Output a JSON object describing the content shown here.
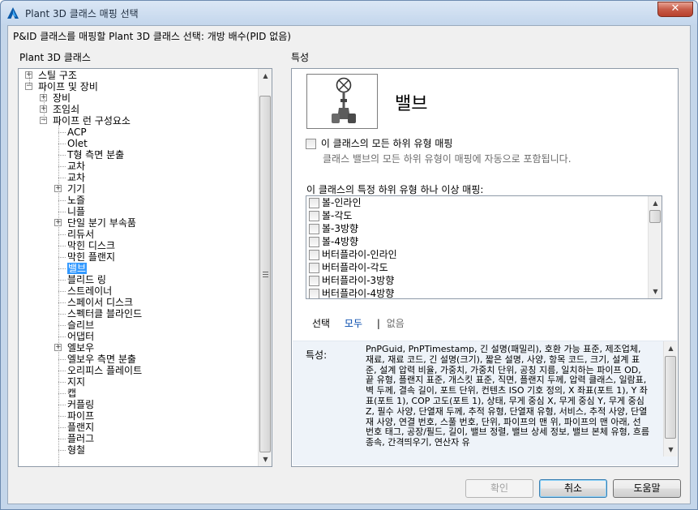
{
  "window": {
    "title": "Plant 3D 클래스 매핑 선택",
    "close_glyph": "✕"
  },
  "prompt": "P&ID 클래스를 매핑할 Plant 3D 클래스 선택: 개방 배수(PID 없음)",
  "left_label": "Plant 3D 클래스",
  "right_label": "특성",
  "tree": {
    "items": [
      {
        "label": "스틸 구조",
        "level": 0,
        "expander": "+"
      },
      {
        "label": "파이프 및 장비",
        "level": 0,
        "expander": "−"
      },
      {
        "label": "장비",
        "level": 1,
        "expander": "+"
      },
      {
        "label": "조임쇠",
        "level": 1,
        "expander": "+"
      },
      {
        "label": "파이프 런 구성요소",
        "level": 1,
        "expander": "−"
      },
      {
        "label": "ACP",
        "level": 2,
        "expander": ""
      },
      {
        "label": "Olet",
        "level": 2,
        "expander": ""
      },
      {
        "label": "T형 측면 분출",
        "level": 2,
        "expander": ""
      },
      {
        "label": "교차",
        "level": 2,
        "expander": ""
      },
      {
        "label": "교차",
        "level": 2,
        "expander": ""
      },
      {
        "label": "기기",
        "level": 2,
        "expander": "+"
      },
      {
        "label": "노즐",
        "level": 2,
        "expander": ""
      },
      {
        "label": "니플",
        "level": 2,
        "expander": ""
      },
      {
        "label": "단일 분기 부속품",
        "level": 2,
        "expander": "+"
      },
      {
        "label": "리듀서",
        "level": 2,
        "expander": ""
      },
      {
        "label": "막힌 디스크",
        "level": 2,
        "expander": ""
      },
      {
        "label": "막힌 플랜지",
        "level": 2,
        "expander": ""
      },
      {
        "label": "밸브",
        "level": 2,
        "expander": "",
        "selected": true
      },
      {
        "label": "블리드 링",
        "level": 2,
        "expander": ""
      },
      {
        "label": "스트레이너",
        "level": 2,
        "expander": ""
      },
      {
        "label": "스페이서 디스크",
        "level": 2,
        "expander": ""
      },
      {
        "label": "스펙터클 블라인드",
        "level": 2,
        "expander": ""
      },
      {
        "label": "슬리브",
        "level": 2,
        "expander": ""
      },
      {
        "label": "어댑터",
        "level": 2,
        "expander": ""
      },
      {
        "label": "엘보우",
        "level": 2,
        "expander": "+"
      },
      {
        "label": "엘보우 측면 분출",
        "level": 2,
        "expander": ""
      },
      {
        "label": "오리피스 플레이트",
        "level": 2,
        "expander": ""
      },
      {
        "label": "지지",
        "level": 2,
        "expander": ""
      },
      {
        "label": "캡",
        "level": 2,
        "expander": ""
      },
      {
        "label": "커플링",
        "level": 2,
        "expander": ""
      },
      {
        "label": "파이프",
        "level": 2,
        "expander": ""
      },
      {
        "label": "플랜지",
        "level": 2,
        "expander": ""
      },
      {
        "label": "플러그",
        "level": 2,
        "expander": ""
      },
      {
        "label": "형철",
        "level": 2,
        "expander": ""
      }
    ]
  },
  "scroll": {
    "up": "▲",
    "down": "▼",
    "thumb_grip": "≡"
  },
  "panel": {
    "class_name": "밸브",
    "map_all_label": "이 클래스의 모든 하위 유형 매핑",
    "map_all_desc": "클래스 밸브의 모든 하위 유형이 매핑에 자동으로 포함됩니다.",
    "specific_label": "이 클래스의 특정 하위 유형 하나 이상 매핑:",
    "subtypes": [
      "볼-인라인",
      "볼-각도",
      "볼-3방향",
      "볼-4방향",
      "버터플라이-인라인",
      "버터플라이-각도",
      "버터플라이-3방향",
      "버터플라이-4방향"
    ],
    "select_label": "선택",
    "select_all": "모두",
    "select_sep": "|",
    "select_none": "없음",
    "props_label": "특성:",
    "props_text": "PnPGuid, PnPTimestamp, 긴 설명(패밀리), 호환 가능 표준, 제조업체, 재료, 재료 코드, 긴 설명(크기), 짧은 설명, 사양, 항목 코드, 크기, 설계 표준, 설계 압력 비율, 가중치, 가중치 단위, 공칭 지름, 일치하는 파이프 OD, 끝 유형, 플랜지 표준, 개스킷 표준, 직면, 플랜지 두께, 압력 클래스, 일람표, 벽 두께, 결속 길이, 포트 단위, 컨텐츠 ISO 기호 정의, X 좌표(포트 1), Y 좌표(포트 1), COP 고도(포트 1), 상태, 무게 중심 X, 무게 중심 Y, 무게 중심 Z, 필수 사양, 단열재 두께, 추적 유형, 단열재 유형, 서비스, 추적 사양, 단열재 사양, 연결 번호, 스풀 번호, 단위, 파이프의 맨 위, 파이프의 맨 아래, 선 번호 태그, 공장/필드, 길이, 밸브 정렬, 밸브 상세 정보, 밸브 본체 유형, 흐름 종속, 간격띄우기, 연산자 유"
  },
  "buttons": {
    "ok": "확인",
    "cancel": "취소",
    "help": "도움말"
  },
  "colors": {
    "selection": "#3399ff",
    "link": "#0047ab",
    "titlebar": "#c4d6ea"
  }
}
